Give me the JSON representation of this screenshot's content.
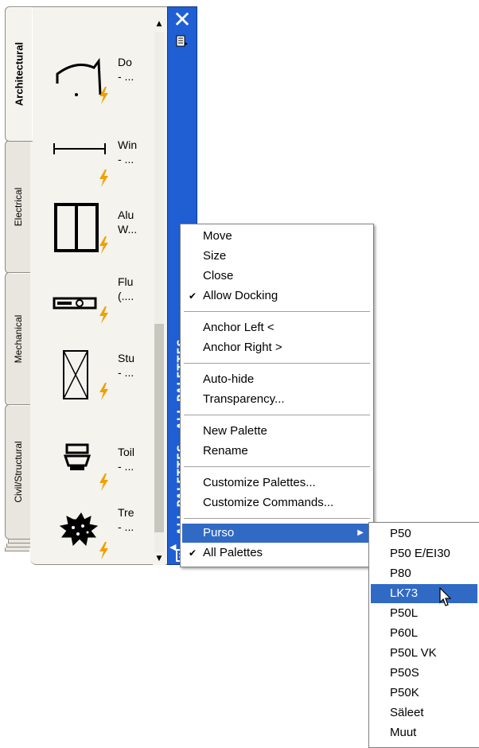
{
  "palette": {
    "tabs": [
      {
        "label": "Architectural",
        "active": true
      },
      {
        "label": "Electrical",
        "active": false
      },
      {
        "label": "Mechanical",
        "active": false
      },
      {
        "label": "Civil/Structural",
        "active": false
      }
    ],
    "tools": [
      {
        "icon": "door-icon",
        "label_line1": "Do",
        "label_line2": "- ..."
      },
      {
        "icon": "window-icon",
        "label_line1": "Win",
        "label_line2": "- ..."
      },
      {
        "icon": "aluminum-window-icon",
        "label_line1": "Alu",
        "label_line2": "W..."
      },
      {
        "icon": "fluorescent-icon",
        "label_line1": "Flu",
        "label_line2": "(...."
      },
      {
        "icon": "stud-icon",
        "label_line1": "Stu",
        "label_line2": "- ..."
      },
      {
        "icon": "toilet-icon",
        "label_line1": "Toil",
        "label_line2": "- ..."
      },
      {
        "icon": "tree-icon",
        "label_line1": "Tre",
        "label_line2": "- ..."
      }
    ],
    "title_vertical": "ALL PALETTES - ALL PALETTES",
    "close_glyph": "✕"
  },
  "menu": {
    "groups": [
      [
        {
          "label": "Move",
          "checked": false
        },
        {
          "label": "Size",
          "checked": false
        },
        {
          "label": "Close",
          "checked": false
        },
        {
          "label": "Allow Docking",
          "checked": true
        }
      ],
      [
        {
          "label": "Anchor Left  <",
          "checked": false
        },
        {
          "label": "Anchor Right  >",
          "checked": false
        }
      ],
      [
        {
          "label": "Auto-hide",
          "checked": false
        },
        {
          "label": "Transparency...",
          "checked": false
        }
      ],
      [
        {
          "label": "New Palette",
          "checked": false
        },
        {
          "label": "Rename",
          "checked": false
        }
      ],
      [
        {
          "label": "Customize Palettes...",
          "checked": false
        },
        {
          "label": "Customize Commands...",
          "checked": false
        }
      ],
      [
        {
          "label": "Purso",
          "checked": false,
          "submenu": true,
          "highlighted": true
        },
        {
          "label": "All Palettes",
          "checked": true
        }
      ]
    ],
    "check_glyph": "✔",
    "arrow_glyph": "▶"
  },
  "submenu": {
    "items": [
      "P50",
      "P50 E/EI30",
      "P80",
      "LK73",
      "P50L",
      "P60L",
      "P50L VK",
      "P50S",
      "P50K",
      "Säleet",
      "Muut"
    ],
    "highlighted_index": 3
  },
  "colors": {
    "titlebar": "#1f5fd3",
    "highlight": "#316ac5",
    "bolt": "#f0a000"
  }
}
